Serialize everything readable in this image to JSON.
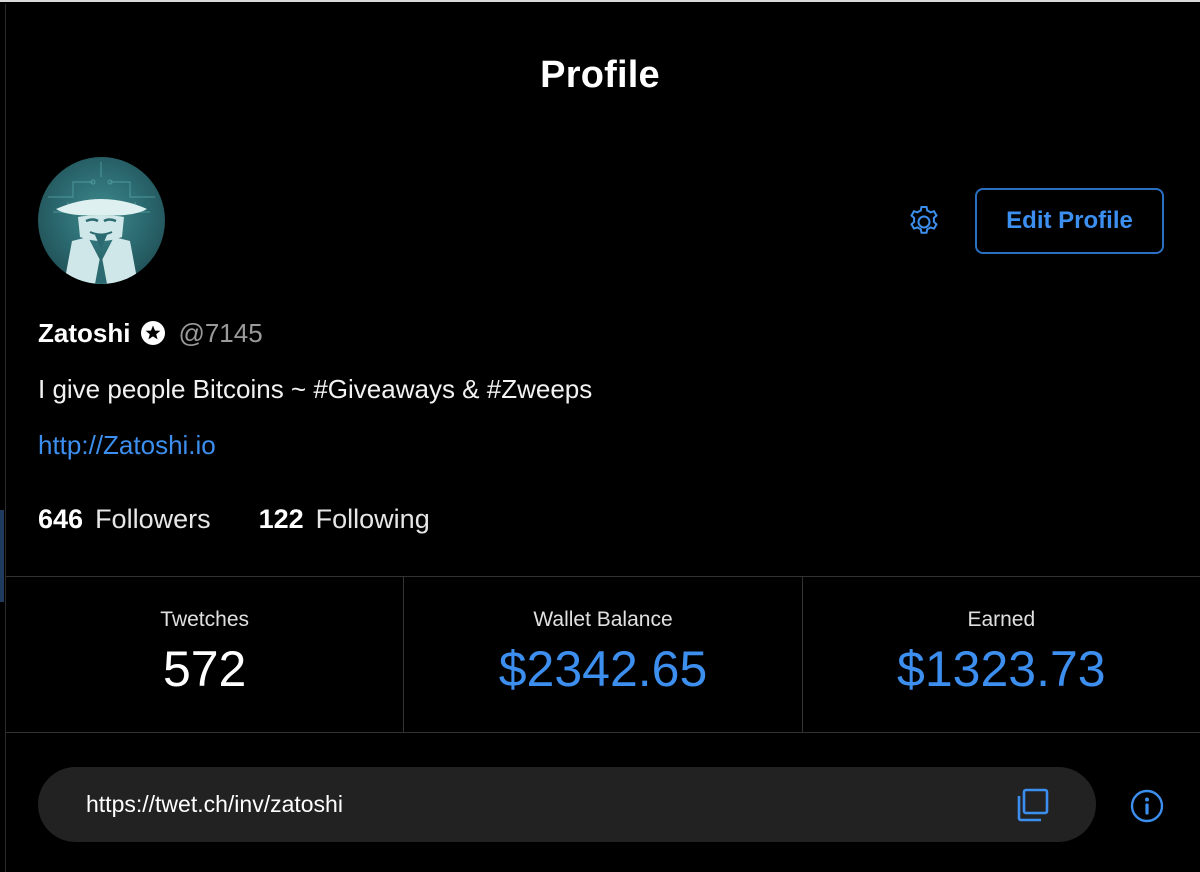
{
  "header": {
    "title": "Profile"
  },
  "profile": {
    "display_name": "Zatoshi",
    "handle": "@7145",
    "bio": "I give people Bitcoins ~ #Giveaways & #Zweeps",
    "link": "http://Zatoshi.io",
    "avatar_icon": "masked-figure-avatar",
    "verified_icon": "star-badge-icon"
  },
  "actions": {
    "settings_icon": "gear-icon",
    "edit_label": "Edit Profile"
  },
  "follow": {
    "followers_count": "646",
    "followers_label": "Followers",
    "following_count": "122",
    "following_label": "Following"
  },
  "stats": [
    {
      "label": "Twetches",
      "value": "572"
    },
    {
      "label": "Wallet Balance",
      "value": "$2342.65"
    },
    {
      "label": "Earned",
      "value": "$1323.73"
    }
  ],
  "invite": {
    "url": "https://twet.ch/inv/zatoshi",
    "copy_icon": "copy-icon",
    "info_icon": "info-icon"
  },
  "colors": {
    "background": "#000000",
    "accent_blue": "#3d8fef",
    "muted_text": "#9a9a9a",
    "panel": "#222222"
  }
}
